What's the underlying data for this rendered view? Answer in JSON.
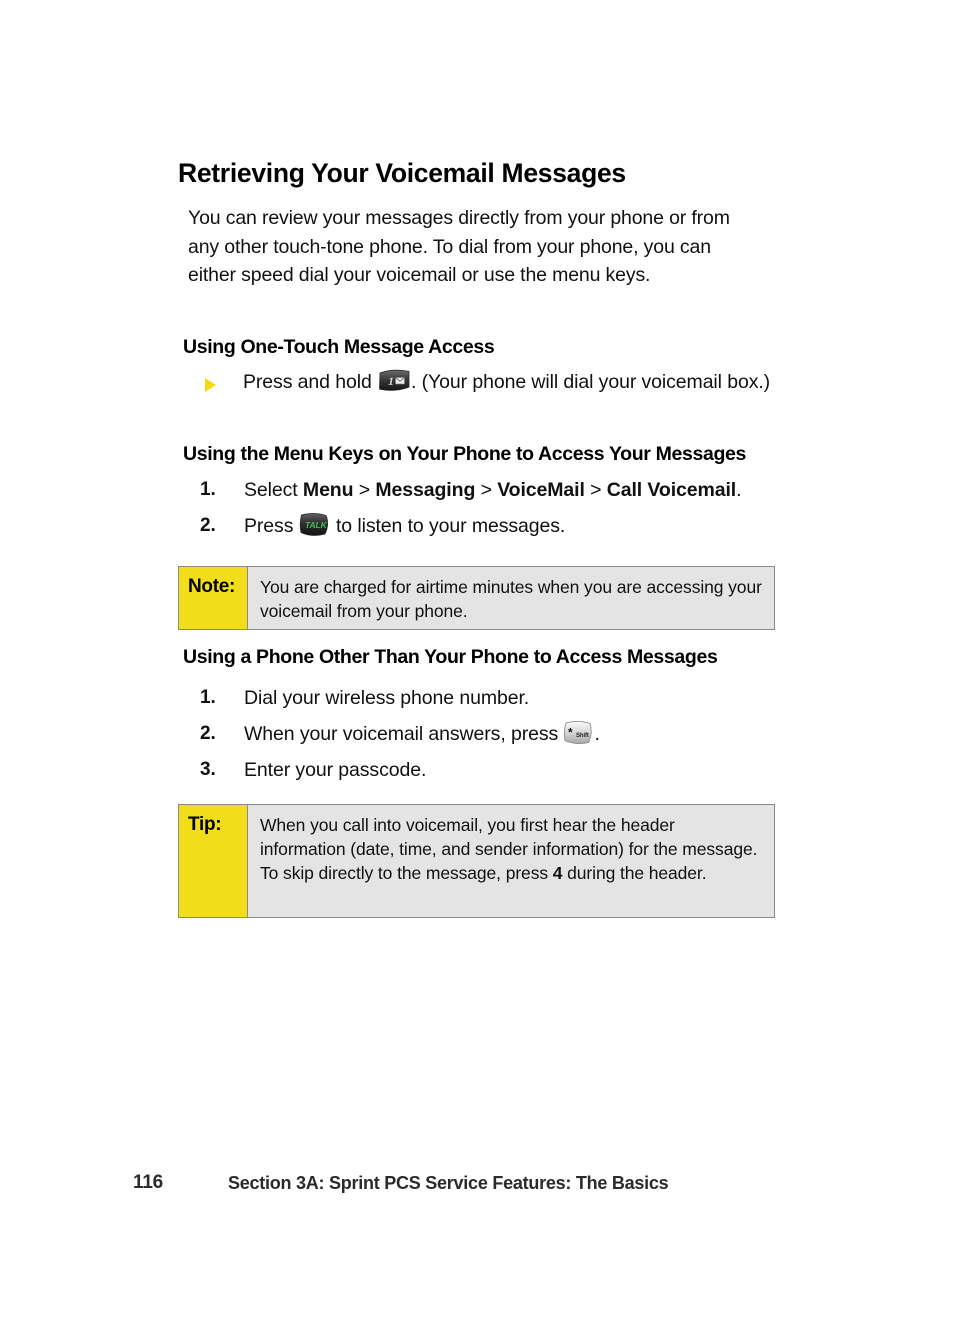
{
  "page": {
    "heading": "Retrieving Your Voicemail Messages",
    "intro": "You can review your messages directly from your phone or from any other touch-tone phone. To dial from your phone, you can either speed dial your voicemail or use the menu keys.",
    "section_one_touch": {
      "heading": "Using One-Touch Message Access",
      "bullet_before_icon": "Press and hold ",
      "bullet_icon": "one-key-voicemail-icon",
      "bullet_after_icon": ". (Your phone will dial your voicemail box.)"
    },
    "section_menu_keys": {
      "heading": "Using the Menu Keys on Your Phone to Access Your Messages",
      "items": [
        {
          "number": "1.",
          "prefix": "Select ",
          "path": [
            "Menu",
            "Messaging",
            "VoiceMail",
            "Call Voicemail"
          ],
          "separator": " > ",
          "suffix": "."
        },
        {
          "number": "2.",
          "prefix": "Press ",
          "icon": "talk-key-icon",
          "icon_label": "TALK",
          "suffix": " to listen to your messages."
        }
      ]
    },
    "note_box": {
      "label": "Note:",
      "text": "You are charged for airtime minutes when you are accessing your voicemail from your phone."
    },
    "section_other_phone": {
      "heading": "Using a Phone Other Than Your Phone to Access Messages",
      "items": [
        {
          "number": "1.",
          "prefix": "Dial your wireless phone number.",
          "icon": null,
          "suffix": ""
        },
        {
          "number": "2.",
          "prefix": "When your voicemail answers, press ",
          "icon": "star-shift-key-icon",
          "icon_label": "Shift",
          "suffix": "."
        },
        {
          "number": "3.",
          "prefix": "Enter your passcode.",
          "icon": null,
          "suffix": ""
        }
      ]
    },
    "tip_box": {
      "label": "Tip:",
      "text_part1": "When you call into voicemail, you first hear the header information (date, time, and sender information) for the message. To skip directly to the message, press ",
      "emphasis": "4",
      "text_part2": " during the header."
    },
    "footer": {
      "page_number": "116",
      "section_title": "Section 3A: Sprint PCS Service Features: The Basics"
    },
    "colors": {
      "callout_label_bg": "#F2DD1A",
      "callout_body_bg": "#E4E4E4",
      "callout_border": "#8A8A8A",
      "bullet_triangle": "#F5D912",
      "talk_key_text": "#3FBF56",
      "page_bg": "#FFFFFF",
      "text": "#111111"
    }
  }
}
